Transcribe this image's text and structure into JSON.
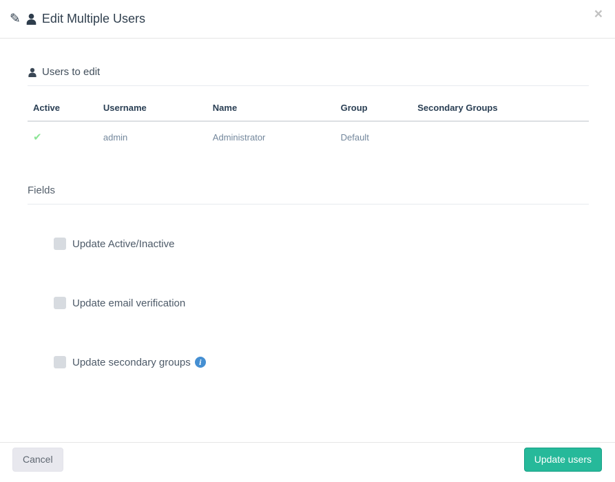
{
  "modal": {
    "title": "Edit Multiple Users"
  },
  "icons": {
    "pencil": "✎",
    "check": "✔",
    "close": "×",
    "info": "i"
  },
  "users_section": {
    "title": "Users to edit",
    "table": {
      "headers": [
        "Active",
        "Username",
        "Name",
        "Group",
        "Secondary Groups"
      ],
      "rows": [
        {
          "active": "true",
          "username": "admin",
          "name": "Administrator",
          "group": "Default",
          "secondary_groups": ""
        }
      ]
    }
  },
  "fields_section": {
    "title": "Fields",
    "checkboxes": [
      {
        "label": "Update Active/Inactive",
        "checked": false,
        "has_info": false
      },
      {
        "label": "Update email verification",
        "checked": false,
        "has_info": false
      },
      {
        "label": "Update secondary groups",
        "checked": false,
        "has_info": true
      }
    ]
  },
  "footer": {
    "cancel_label": "Cancel",
    "submit_label": "Update users"
  },
  "colors": {
    "accent_green": "#26b99a",
    "check_green": "#8ce596",
    "info_blue": "#458fd2",
    "heading_dark": "#2a3f54",
    "body_text": "#73879c"
  }
}
